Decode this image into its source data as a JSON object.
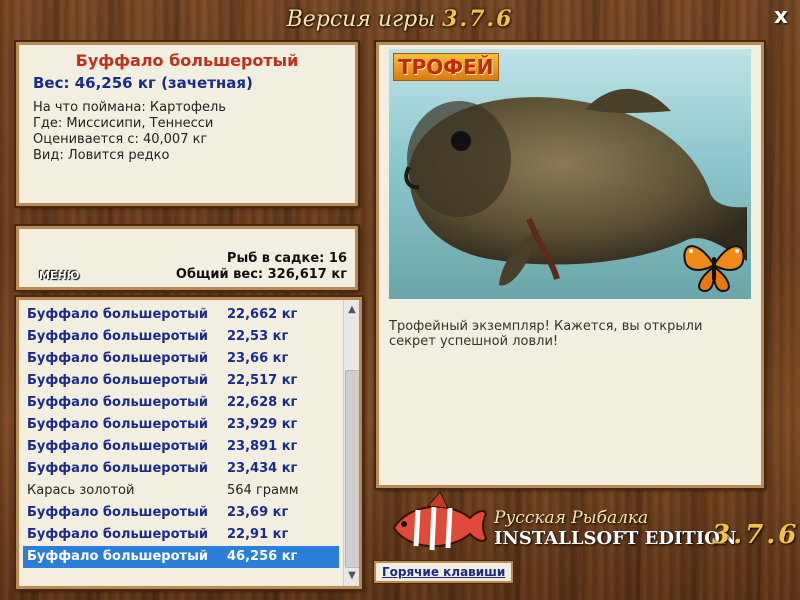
{
  "header": {
    "title_prefix": "Версия игры",
    "version": "3.7.6",
    "close_label": "x"
  },
  "fish_info": {
    "name": "Буффало большеротый",
    "weight_line": "Вес: 46,256 кг (зачетная)",
    "bait_line": "На что поймана: Картофель",
    "location_line": "Где: Миссисипи, Теннесси",
    "rated_line": "Оценивается с: 40,007 кг",
    "kind_line": "Вид: Ловится редко"
  },
  "stats": {
    "fish_count_line": "Рыб в садке: 16",
    "total_weight_line": "Общий вес: 326,617 кг",
    "menu_label": "МЕНЮ"
  },
  "catch_list": [
    {
      "name": "Буффало большеротый",
      "weight": "22,662 кг",
      "style": "blue"
    },
    {
      "name": "Буффало большеротый",
      "weight": "22,53 кг",
      "style": "blue"
    },
    {
      "name": "Буффало большеротый",
      "weight": "23,66 кг",
      "style": "blue"
    },
    {
      "name": "Буффало большеротый",
      "weight": "22,517 кг",
      "style": "blue"
    },
    {
      "name": "Буффало большеротый",
      "weight": "22,628 кг",
      "style": "blue"
    },
    {
      "name": "Буффало большеротый",
      "weight": "23,929 кг",
      "style": "blue"
    },
    {
      "name": "Буффало большеротый",
      "weight": "23,891 кг",
      "style": "blue"
    },
    {
      "name": "Буффало большеротый",
      "weight": "23,434 кг",
      "style": "blue"
    },
    {
      "name": "Карась золотой",
      "weight": "564 грамм",
      "style": "plain"
    },
    {
      "name": "Буффало большеротый",
      "weight": "23,69 кг",
      "style": "blue"
    },
    {
      "name": "Буффало большеротый",
      "weight": "22,91 кг",
      "style": "blue"
    },
    {
      "name": "Буффало большеротый",
      "weight": "46,256 кг",
      "style": "sel"
    }
  ],
  "photo": {
    "badge": "ТРОФЕЙ",
    "description": "Трофейный экземпляр! Кажется, вы открыли секрет успешной ловли!"
  },
  "logo": {
    "line1": "Русская Рыбалка",
    "line2": "INSTALLSOFT EDITION",
    "version": "3.7.6"
  },
  "footer": {
    "hotkeys_label": "Горячие клавиши"
  },
  "colors": {
    "selected_row": "#2b7fd8",
    "fish_name": "#c0311b",
    "blue_text": "#1a2b8a"
  }
}
